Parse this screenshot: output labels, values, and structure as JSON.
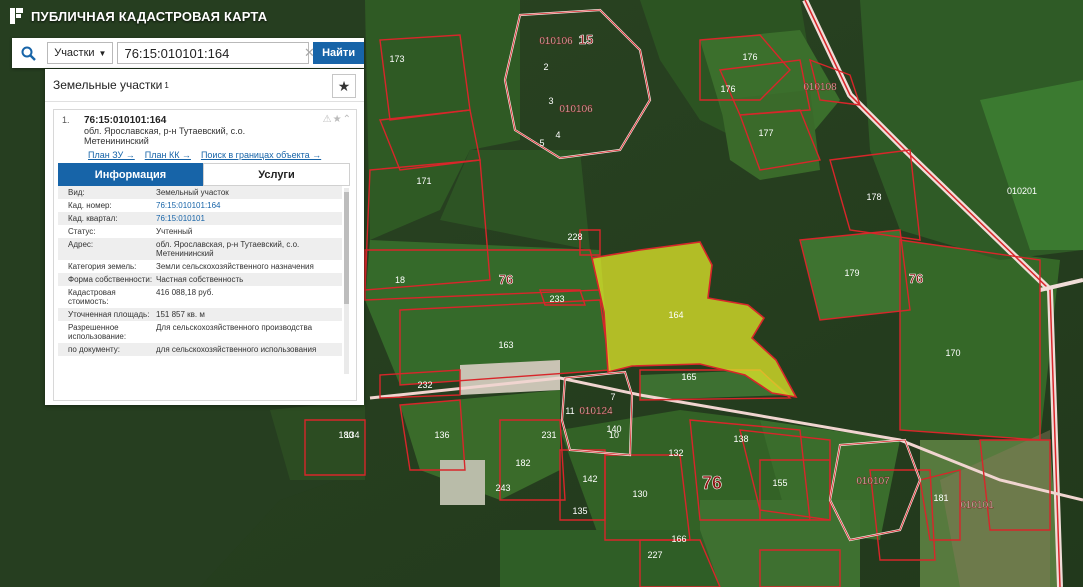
{
  "app": {
    "title": "ПУБЛИЧНАЯ КАДАСТРОВАЯ КАРТА"
  },
  "search": {
    "type_label": "Участки",
    "value": "76:15:010101:164",
    "button_label": "Найти"
  },
  "panel": {
    "heading": "Земельные участки",
    "heading_sup": "1",
    "card": {
      "index": "1.",
      "title": "76:15:010101:164",
      "address": "обл. Ярославская, р-н Тутаевский, с.о. Метенининский",
      "links": [
        "План ЗУ →",
        "План КК →",
        "Поиск в границах объекта →"
      ],
      "tabs": {
        "info": "Информация",
        "services": "Услуги"
      },
      "rows": [
        {
          "label": "Вид:",
          "value": "Земельный участок"
        },
        {
          "label": "Кад. номер:",
          "value": "76:15:010101:164"
        },
        {
          "label": "Кад. квартал:",
          "value": "76:15:010101"
        },
        {
          "label": "Статус:",
          "value": "Учтенный"
        },
        {
          "label": "Адрес:",
          "value": "обл. Ярославская, р-н Тутаевский, с.о. Метенининский"
        },
        {
          "label": "Категория земель:",
          "value": "Земли сельскохозяйственного назначения"
        },
        {
          "label": "Форма собственности:",
          "value": "Частная собственность"
        },
        {
          "label": "Кадастровая стоимость:",
          "value": "416 088,18 руб."
        },
        {
          "label": "Уточненная площадь:",
          "value": "151 857 кв. м"
        },
        {
          "label": "Разрешенное использование:",
          "value": "Для сельскохозяйственного производства"
        },
        {
          "label": "по документу:",
          "value": "для сельскохозяйственного использования"
        }
      ]
    }
  },
  "map": {
    "labels": [
      "173",
      "176",
      "176",
      "177",
      "178",
      "179",
      "170",
      "171",
      "18",
      "76",
      "76",
      "76",
      "134",
      "163",
      "165",
      "180",
      "181",
      "182",
      "136",
      "142",
      "130",
      "132",
      "135",
      "138",
      "140",
      "155",
      "166",
      "227",
      "228",
      "231",
      "232",
      "233",
      "243",
      "15",
      "2",
      "3",
      "4",
      "5",
      "7",
      "10",
      "11",
      "010106",
      "010106",
      "010124",
      "010107",
      "010101",
      "010201",
      "010108"
    ],
    "colors": {
      "boundary": "#d8262a",
      "selected_fill": "#e2e82a",
      "quarter_line": "#ffffff"
    }
  },
  "colors": {
    "accent": "#1764a8"
  }
}
